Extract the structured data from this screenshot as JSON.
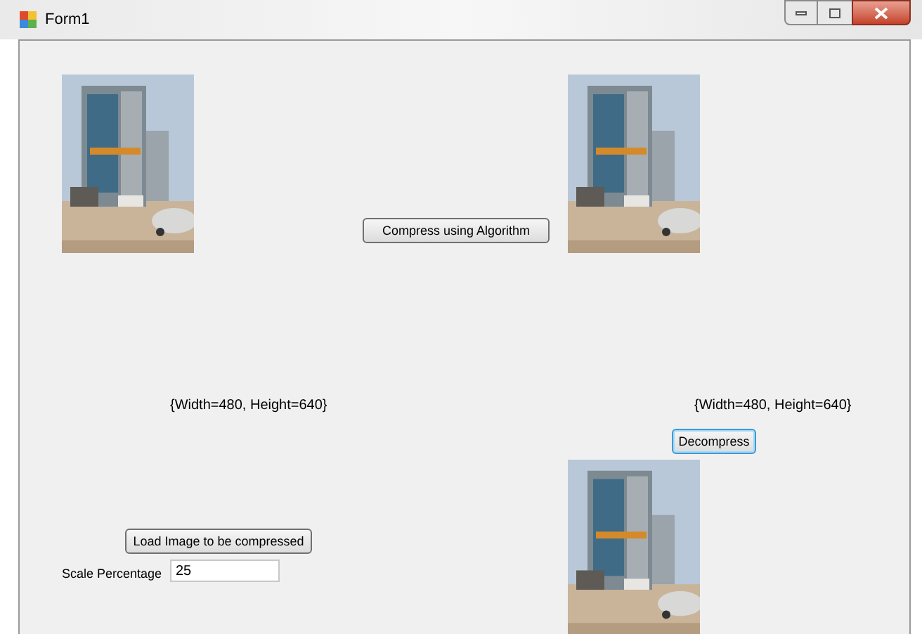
{
  "window": {
    "title": "Form1"
  },
  "pictures": [
    {
      "kind": "picture"
    },
    {
      "kind": "picture"
    },
    {
      "kind": "picture"
    }
  ],
  "compress_button": {
    "label": "Compress using Algorithm",
    "focused": false
  },
  "size_labels": [
    "{Width=480, Height=640}",
    "{Width=480, Height=640}"
  ],
  "decompress_button": {
    "label": "Decompress",
    "focused": true
  },
  "load_button": {
    "label": "Load Image to be compressed",
    "focused": false
  },
  "scale": {
    "label": "Scale Percentage",
    "value": "25"
  }
}
